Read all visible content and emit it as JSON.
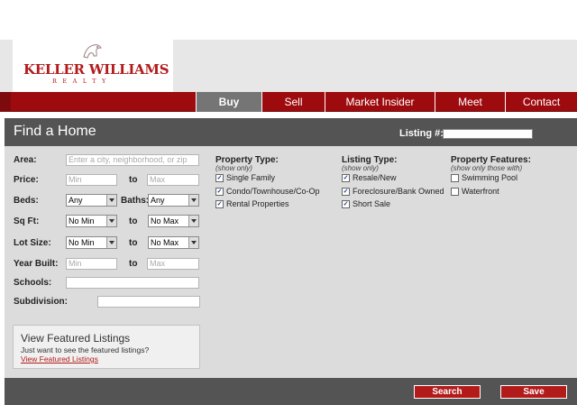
{
  "brand": {
    "name": "KELLER WILLIAMS",
    "tagline": "REALTY",
    "color": "#b31b1b"
  },
  "nav": {
    "items": [
      {
        "label": "Buy",
        "active": true
      },
      {
        "label": "Sell",
        "active": false
      },
      {
        "label": "Market Insider",
        "active": false
      },
      {
        "label": "Meet",
        "active": false
      },
      {
        "label": "Contact",
        "active": false
      }
    ]
  },
  "panel": {
    "title": "Find a Home",
    "listing_label": "Listing #:",
    "listing_value": ""
  },
  "form": {
    "area": {
      "label": "Area:",
      "placeholder": "Enter a city, neighborhood, or zip"
    },
    "price": {
      "label": "Price:",
      "min_placeholder": "Min",
      "to": "to",
      "max_placeholder": "Max"
    },
    "beds": {
      "label": "Beds:",
      "value": "Any"
    },
    "baths": {
      "label": "Baths:",
      "value": "Any"
    },
    "sqft": {
      "label": "Sq Ft:",
      "min_value": "No Min",
      "to": "to",
      "max_value": "No Max"
    },
    "lot_size": {
      "label": "Lot Size:",
      "min_value": "No Min",
      "to": "to",
      "max_value": "No Max"
    },
    "year_built": {
      "label": "Year Built:",
      "min_placeholder": "Min",
      "to": "to",
      "max_placeholder": "Max"
    },
    "schools": {
      "label": "Schools:",
      "value": ""
    },
    "subdivision": {
      "label": "Subdivision:",
      "value": ""
    }
  },
  "property_type": {
    "heading": "Property Type:",
    "sub": "(show only)",
    "options": [
      {
        "label": "Single Family",
        "checked": true
      },
      {
        "label": "Condo/Townhouse/Co-Op",
        "checked": true
      },
      {
        "label": "Rental Properties",
        "checked": true
      }
    ]
  },
  "listing_type": {
    "heading": "Listing Type:",
    "sub": "(show only)",
    "options": [
      {
        "label": "Resale/New",
        "checked": true
      },
      {
        "label": "Foreclosure/Bank Owned",
        "checked": true
      },
      {
        "label": "Short Sale",
        "checked": true
      }
    ]
  },
  "property_features": {
    "heading": "Property Features:",
    "sub": "(show only those with)",
    "options": [
      {
        "label": "Swimming Pool",
        "checked": false
      },
      {
        "label": "Waterfront",
        "checked": false
      }
    ]
  },
  "featured": {
    "title": "View Featured Listings",
    "description": "Just want to see the featured listings?",
    "link": "View Featured Listings"
  },
  "actions": {
    "search": "Search",
    "save": "Save"
  }
}
